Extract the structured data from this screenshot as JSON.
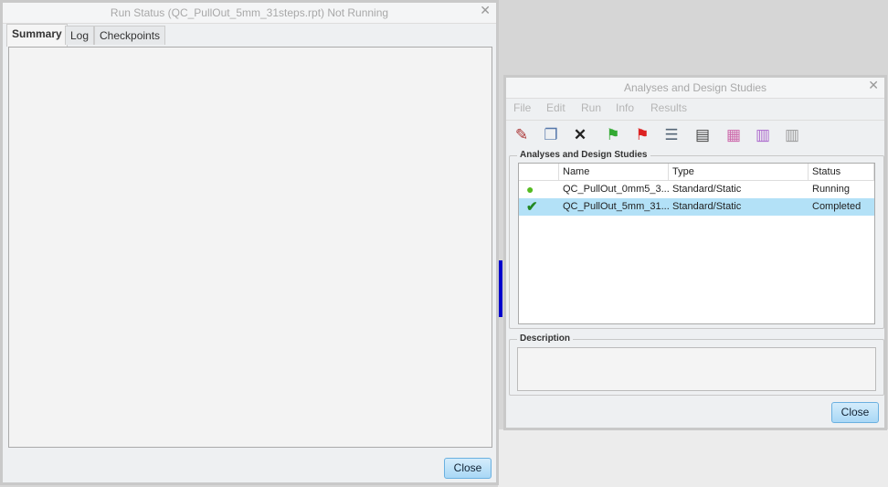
{
  "run_status": {
    "title": "Run Status (QC_PullOut_5mm_31steps.rpt) Not Running",
    "tabs": [
      "Summary",
      "Log",
      "Checkpoints"
    ],
    "active_tab": "Summary",
    "close_label": "Close",
    "x_glyph": "✕"
  },
  "studies": {
    "title": "Analyses and Design Studies",
    "x_glyph": "✕",
    "menu": [
      "File",
      "Edit",
      "Run",
      "Info",
      "Results"
    ],
    "toolbar": [
      "pencil-icon",
      "copy-icon",
      "delete-icon",
      "green-flag-icon",
      "red-flag-icon",
      "checklist-icon",
      "report-icon",
      "results-icon",
      "compare-icon",
      "compare-gray-icon"
    ],
    "group_label": "Analyses and Design Studies",
    "columns": [
      "",
      "Name",
      "Type",
      "Status"
    ],
    "rows": [
      {
        "icon": "running-icon",
        "name": "QC_PullOut_0mm5_3...",
        "type": "Standard/Static",
        "status": "Running",
        "selected": false
      },
      {
        "icon": "check-icon",
        "name": "QC_PullOut_5mm_31...",
        "type": "Standard/Static",
        "status": "Completed",
        "selected": true
      }
    ],
    "description_label": "Description",
    "close_label": "Close"
  },
  "colors": {
    "selection": "#b3e1f7",
    "accent_bar": "#0000cc"
  }
}
